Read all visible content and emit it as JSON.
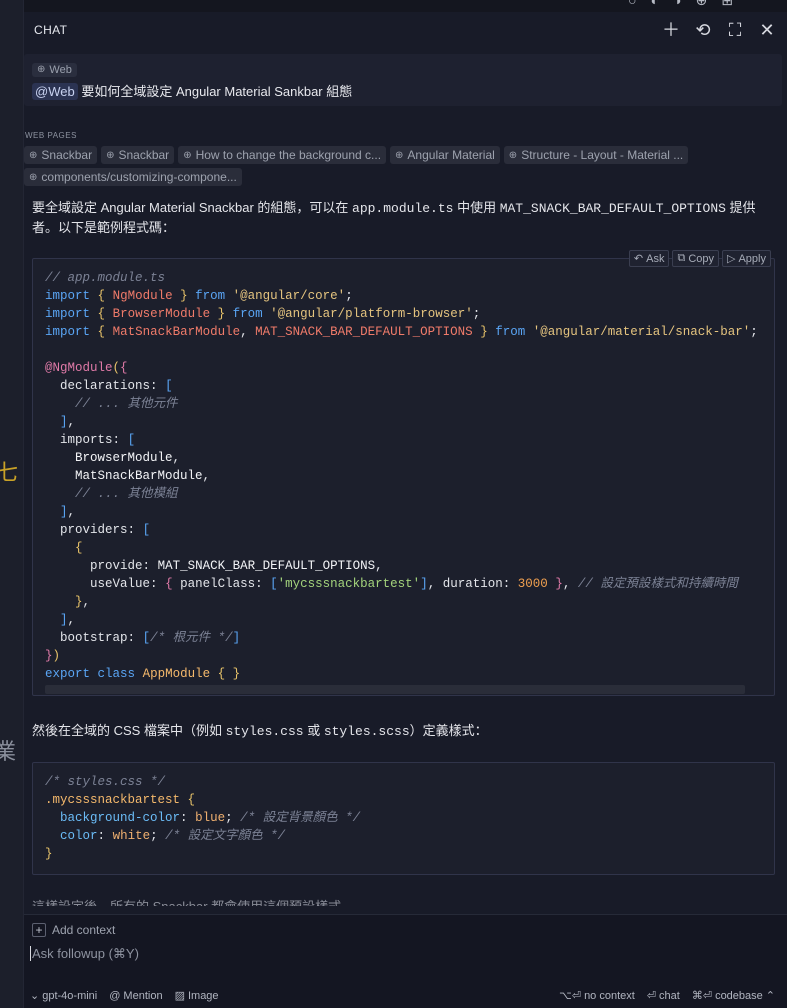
{
  "header": {
    "title": "CHAT"
  },
  "query": {
    "chip": "Web",
    "mention": "@Web",
    "text": "要如何全域設定 Angular Material Sankbar 組態"
  },
  "web_pages": {
    "label": "WEB PAGES",
    "items": [
      "Snackbar",
      "Snackbar",
      "How to change the background c...",
      "Angular Material",
      "Structure - Layout - Material ...",
      "components/customizing-compone..."
    ]
  },
  "answer": {
    "intro_1": "要全域設定 Angular Material Snackbar 的組態，可以在 ",
    "intro_code1": "app.module.ts",
    "intro_2": " 中使用 ",
    "intro_code2": "MAT_SNACK_BAR_DEFAULT_OPTIONS",
    "intro_3": " 提供者。以下是範例程式碼：",
    "mid_1": "然後在全域的 CSS 檔案中（例如 ",
    "mid_code1": "styles.css",
    "mid_2": " 或 ",
    "mid_code2": "styles.scss",
    "mid_3": "）定義樣式：",
    "truncated": "這樣設定後，所有的 Snackbar 都會使用這個預設樣式。"
  },
  "code_actions": {
    "ask": "Ask",
    "copy": "Copy",
    "apply": "Apply"
  },
  "code1": {
    "comment_file": "// app.module.ts",
    "import": "import",
    "from": "from",
    "ngmodule": "NgModule",
    "core": "'@angular/core'",
    "browsermodule": "BrowserModule",
    "platform": "'@angular/platform-browser'",
    "matsnack": "MatSnackBarModule",
    "default_opts": "MAT_SNACK_BAR_DEFAULT_OPTIONS",
    "snackbar_pkg": "'@angular/material/snack-bar'",
    "decorator": "@NgModule",
    "declarations": "declarations",
    "comment_components": "// ... 其他元件",
    "imports": "imports",
    "browsermodule2": "BrowserModule",
    "matsnack2": "MatSnackBarModule",
    "comment_modules": "// ... 其他模組",
    "providers": "providers",
    "provide": "provide",
    "default_opts2": "MAT_SNACK_BAR_DEFAULT_OPTIONS",
    "usevalue": "useValue",
    "panelclass": "panelClass",
    "class_str": "'mycsssnackbartest'",
    "duration": "duration",
    "duration_val": "3000",
    "comment_default": "// 設定預設樣式和持續時間",
    "bootstrap": "bootstrap",
    "comment_root": "/* 根元件 */",
    "export": "export",
    "class_kw": "class",
    "appmodule": "AppModule"
  },
  "code2": {
    "comment_file": "/* styles.css */",
    "selector": ".mycsssnackbartest",
    "bg_prop": "background-color",
    "bg_val": "blue",
    "bg_comment": "/* 設定背景顏色 */",
    "color_prop": "color",
    "color_val": "white",
    "color_comment": "/* 設定文字顏色 */"
  },
  "composer": {
    "add_context": "Add context",
    "placeholder": "Ask followup (⌘Y)",
    "model": "gpt-4o-mini",
    "mention": "Mention",
    "image": "Image",
    "no_context": "no context",
    "no_context_key": "⌥⏎",
    "chat": "chat",
    "chat_key": "⏎",
    "codebase": "codebase",
    "codebase_key": "⌘⏎"
  },
  "colors": {
    "background": "#181b28",
    "accent": "#5aa5f5"
  }
}
